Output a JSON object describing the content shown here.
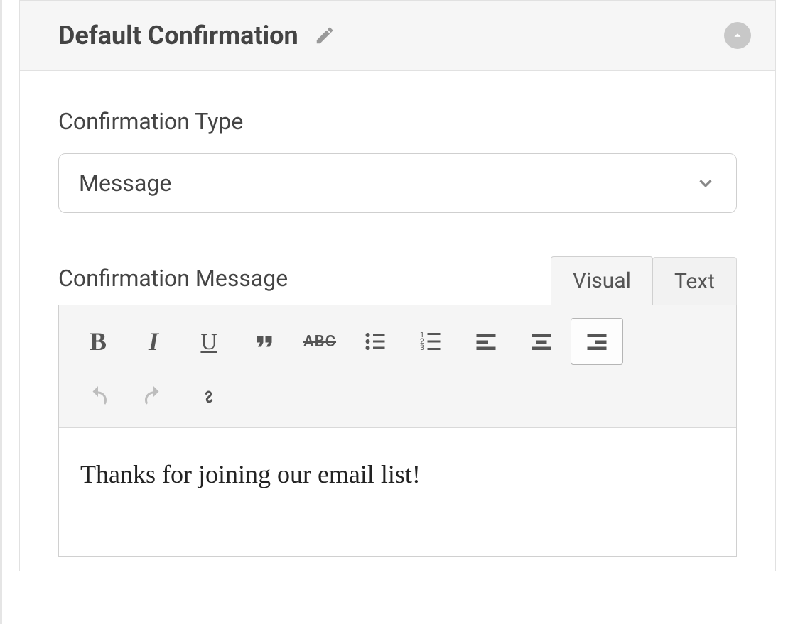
{
  "panel": {
    "title": "Default Confirmation"
  },
  "fields": {
    "type_label": "Confirmation Type",
    "type_value": "Message",
    "message_label": "Confirmation Message"
  },
  "tabs": {
    "visual": "Visual",
    "text": "Text"
  },
  "toolbar": {
    "bold": "B",
    "italic": "I",
    "underline": "U",
    "strike": "ABC"
  },
  "editor": {
    "content": "Thanks for joining our email list!"
  }
}
